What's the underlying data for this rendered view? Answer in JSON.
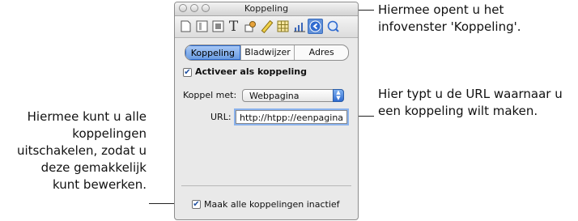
{
  "callouts": {
    "top_right": [
      "Hiermee opent u het",
      "infovenster 'Koppeling'."
    ],
    "mid_right": [
      "Hier typt u de URL waarnaar u",
      "een koppeling wilt maken."
    ],
    "left": [
      "Hiermee kunt u alle",
      "koppelingen",
      "uitschakelen, zodat u",
      "deze gemakkelijk",
      "kunt bewerken."
    ]
  },
  "window": {
    "title": "Koppeling",
    "toolbar_icons": [
      "document-icon",
      "layout-icon",
      "wrap-icon",
      "text-icon",
      "graphic-icon",
      "metrics-icon",
      "table-icon",
      "chart-icon",
      "link-icon",
      "quicktime-icon"
    ],
    "active_toolbar_icon": "link-icon"
  },
  "tabs": [
    {
      "label": "Koppeling",
      "active": true
    },
    {
      "label": "Bladwijzer",
      "active": false
    },
    {
      "label": "Adres",
      "active": false
    }
  ],
  "form": {
    "enable_link_label": "Activeer als koppeling",
    "enable_link_checked": true,
    "link_to_label": "Koppel met:",
    "link_to_value": "Webpagina",
    "url_label": "URL:",
    "url_value": "http://htpp://eenpagina",
    "disable_all_label": "Maak alle koppelingen inactief",
    "disable_all_checked": true
  },
  "colors": {
    "accent": "#5f8fd8",
    "selection": "#8ab2ec"
  }
}
